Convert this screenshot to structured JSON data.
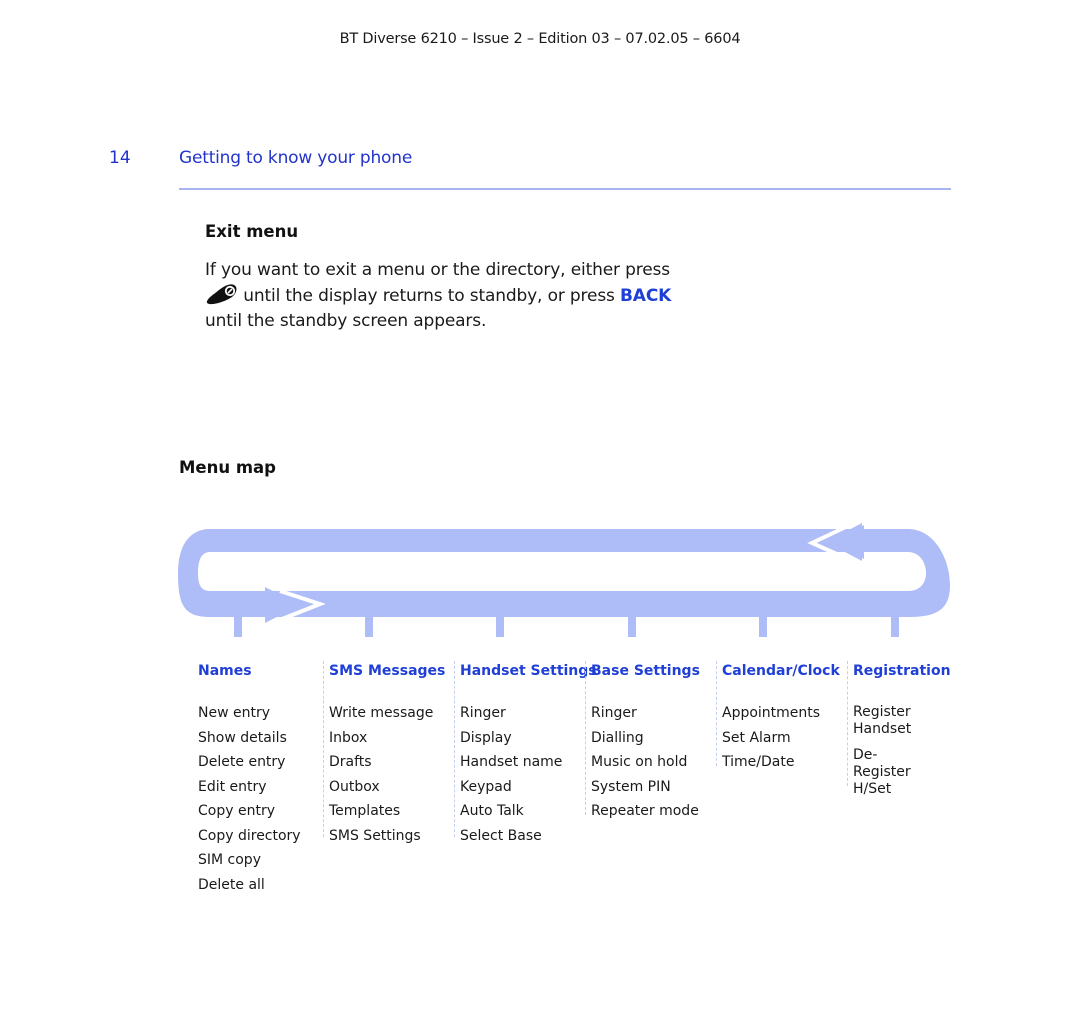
{
  "document": {
    "header": "BT Diverse 6210 – Issue 2 – Edition 03 – 07.02.05 – 6604",
    "page_number": "14",
    "section_title": "Getting to know your phone"
  },
  "exit_menu": {
    "heading": "Exit menu",
    "text_line1": "If you want to exit a menu or the directory, either press",
    "icon": "end-call-key-icon",
    "text_line2": " until the display returns to standby, or press ",
    "back_label": "BACK",
    "text_line3": "until the standby screen appears."
  },
  "menu_map": {
    "heading": "Menu map",
    "colors": {
      "loop": "#aebcf7",
      "heading": "#1f3fd6"
    },
    "columns": [
      {
        "title": "Names",
        "items": [
          "New entry",
          "Show details",
          "Delete entry",
          "Edit entry",
          "Copy entry",
          "Copy directory",
          "SIM copy",
          "Delete all"
        ]
      },
      {
        "title": "SMS Messages",
        "items": [
          "Write message",
          "Inbox",
          "Drafts",
          "Outbox",
          "Templates",
          "SMS Settings"
        ]
      },
      {
        "title": "Handset Settings",
        "items": [
          "Ringer",
          "Display",
          "Handset name",
          "Keypad",
          "Auto Talk",
          "Select Base"
        ]
      },
      {
        "title": "Base Settings",
        "items": [
          "Ringer",
          "Dialling",
          "Music on hold",
          "System PIN",
          "Repeater mode"
        ]
      },
      {
        "title": "Calendar/Clock",
        "items": [
          "Appointments",
          "Set Alarm",
          "Time/Date"
        ]
      },
      {
        "title": "Registration",
        "items": [
          "Register Handset",
          "De-Register H/Set"
        ]
      }
    ]
  }
}
